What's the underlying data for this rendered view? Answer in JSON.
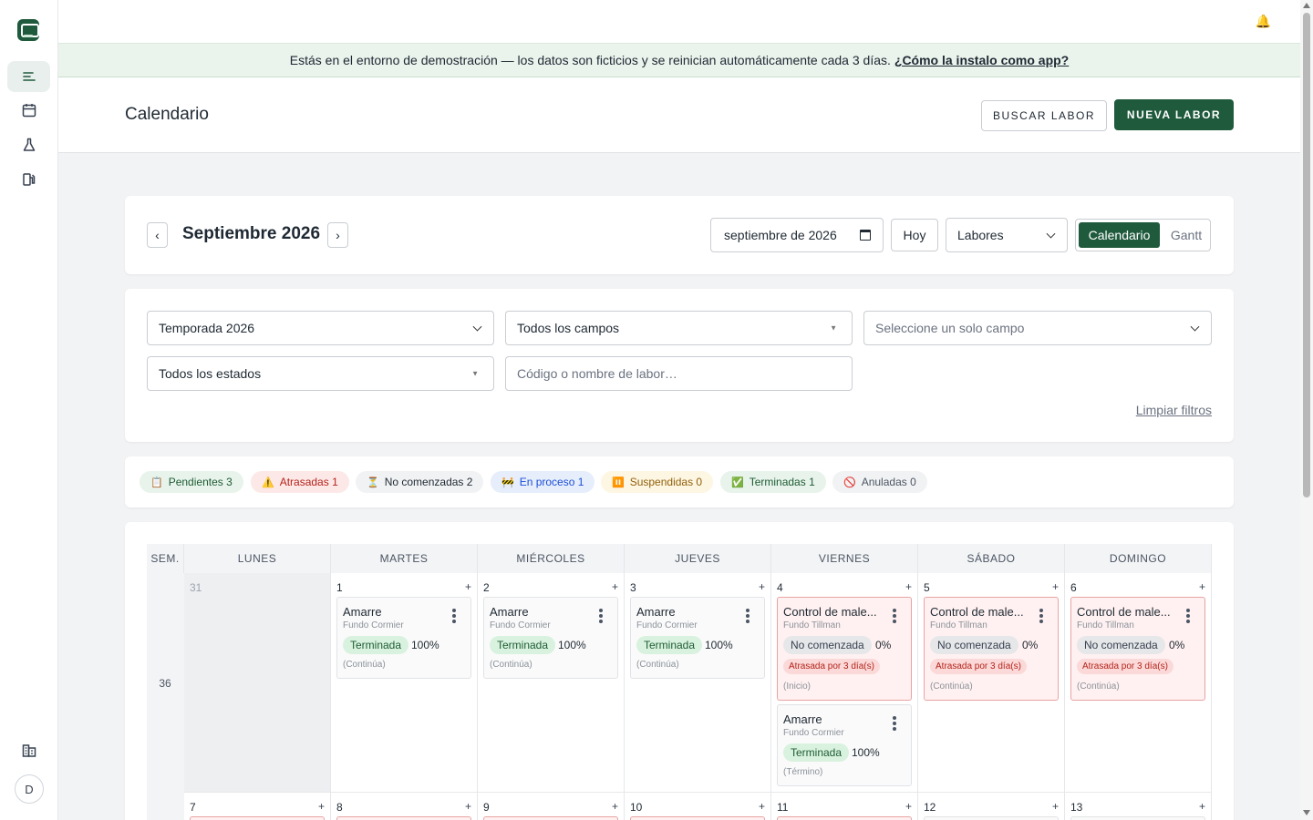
{
  "topbar": {
    "bell_icon": "bell-icon"
  },
  "banner": {
    "text": "Estás en el entorno de demostración — los datos son ficticios y se reinician automáticamente cada 3 días.",
    "link": "¿Cómo la instalo como app?"
  },
  "header": {
    "title": "Calendario",
    "search_button": "BUSCAR LABOR",
    "new_button": "NUEVA LABOR"
  },
  "sidebar": {
    "items": [
      {
        "icon": "list-icon",
        "active": true
      },
      {
        "icon": "calendar-icon",
        "active": false
      },
      {
        "icon": "flask-icon",
        "active": false
      },
      {
        "icon": "fuel-icon",
        "active": false
      }
    ],
    "bottom_icon": "building-icon",
    "avatar": "D"
  },
  "calendar_nav": {
    "prev": "‹",
    "next": "›",
    "month": "Septiembre 2026",
    "date_value": "septiembre de 2026",
    "today": "Hoy",
    "mode_select": "Labores",
    "view_calendar": "Calendario",
    "view_gantt": "Gantt"
  },
  "filters": {
    "season": "Temporada 2026",
    "fields": "Todos los campos",
    "single_field_placeholder": "Seleccione un solo campo",
    "states": "Todos los estados",
    "search_placeholder": "Código o nombre de labor…",
    "clear": "Limpiar filtros"
  },
  "status_pills": [
    {
      "icon": "📋",
      "label": "Pendientes 3",
      "bg": "#e8f3ec",
      "color": "#1d5c32"
    },
    {
      "icon": "⚠️",
      "label": "Atrasadas 1",
      "bg": "#fde8e8",
      "color": "#b42318"
    },
    {
      "icon": "⏳",
      "label": "No comenzadas 2",
      "bg": "#f1f2f4",
      "color": "#1f2933"
    },
    {
      "icon": "🚧",
      "label": "En proceso 1",
      "bg": "#e6eefb",
      "color": "#1d4ed8"
    },
    {
      "icon": "⏸️",
      "label": "Suspendidas 0",
      "bg": "#fdf6e3",
      "color": "#92600a"
    },
    {
      "icon": "✅",
      "label": "Terminadas 1",
      "bg": "#e8f3ec",
      "color": "#1d5c32"
    },
    {
      "icon": "🚫",
      "label": "Anuladas 0",
      "bg": "#f1f2f4",
      "color": "#4b5563"
    }
  ],
  "calendar": {
    "headers": [
      "SEM.",
      "LUNES",
      "MARTES",
      "MIÉRCOLES",
      "JUEVES",
      "VIERNES",
      "SÁBADO",
      "DOMINGO"
    ],
    "weeks": [
      {
        "week": "36",
        "days": [
          {
            "num": "31",
            "other": true,
            "tasks": []
          },
          {
            "num": "1",
            "tasks": [
              {
                "title": "Amarre",
                "field": "Fundo Cormier",
                "status": "Terminada",
                "kind": "done",
                "pct": "100%",
                "note": "(Continúa)"
              }
            ]
          },
          {
            "num": "2",
            "tasks": [
              {
                "title": "Amarre",
                "field": "Fundo Cormier",
                "status": "Terminada",
                "kind": "done",
                "pct": "100%",
                "note": "(Continúa)"
              }
            ]
          },
          {
            "num": "3",
            "tasks": [
              {
                "title": "Amarre",
                "field": "Fundo Cormier",
                "status": "Terminada",
                "kind": "done",
                "pct": "100%",
                "note": "(Continúa)"
              }
            ]
          },
          {
            "num": "4",
            "tasks": [
              {
                "title": "Control de male...",
                "field": "Fundo Tillman",
                "status": "No comenzada",
                "kind": "none",
                "pct": "0%",
                "late": "Atrasada por 3 día(s)",
                "note": "(Inicio)"
              },
              {
                "title": "Amarre",
                "field": "Fundo Cormier",
                "status": "Terminada",
                "kind": "done",
                "pct": "100%",
                "note": "(Término)"
              }
            ]
          },
          {
            "num": "5",
            "tasks": [
              {
                "title": "Control de male...",
                "field": "Fundo Tillman",
                "status": "No comenzada",
                "kind": "none",
                "pct": "0%",
                "late": "Atrasada por 3 día(s)",
                "note": "(Continúa)"
              }
            ]
          },
          {
            "num": "6",
            "tasks": [
              {
                "title": "Control de male...",
                "field": "Fundo Tillman",
                "status": "No comenzada",
                "kind": "none",
                "pct": "0%",
                "late": "Atrasada por 3 día(s)",
                "note": "(Continúa)"
              }
            ]
          }
        ]
      },
      {
        "week": "",
        "days": [
          {
            "num": "7"
          },
          {
            "num": "8"
          },
          {
            "num": "9"
          },
          {
            "num": "10"
          },
          {
            "num": "11"
          },
          {
            "num": "12"
          },
          {
            "num": "13"
          }
        ]
      }
    ],
    "add": "+"
  }
}
